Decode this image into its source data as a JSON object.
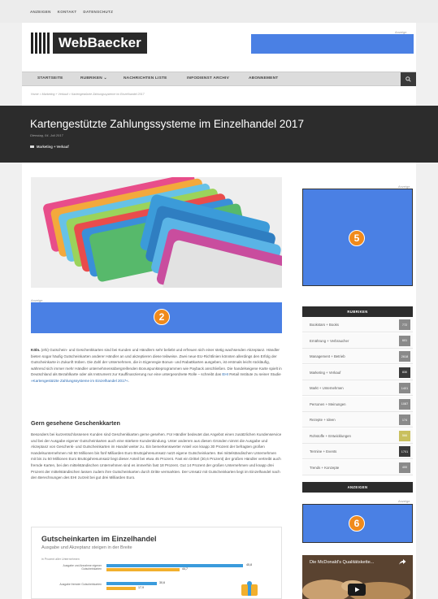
{
  "topbar": {
    "links": [
      "ANZEIGEN",
      "KONTAKT",
      "DATENSCHUTZ"
    ]
  },
  "header": {
    "logo_text": "WebBaecker",
    "ad_label": "Anzeige"
  },
  "nav": {
    "items": [
      "STARTSEITE",
      "RUBRIKEN ⌄",
      "NACHRICHTEN LISTE",
      "INFODIENST ARCHIV",
      "ABONNEMENT"
    ],
    "search_icon": "search-icon"
  },
  "breadcrumb": "Home  >  Marketing + Verkauf  >  Kartengestützte Zahlungssysteme im Einzelhandel 2017",
  "article": {
    "title": "Kartengestützte Zahlungssysteme im Einzelhandel 2017",
    "date": "Dienstag, 04. Juli 2017",
    "category": "Marketing + Verkauf",
    "ad_label": "Anzeige",
    "ad_number": "2",
    "lead_city": "Köln.",
    "lead_text": " (ehi) Gutschein- und Geschenkkarten sind bei Kunden und Händlern sehr beliebt und erfreuen sich einer stetig wachsenden Akzeptanz. Händler bieten sogar häufig Gutscheinkarten anderer Händler an und akzeptieren diese teilweise. Zwei neue EU-Richtlinien könnten allerdings den Erfolg der Gutscheinkarte in Zukunft trüben. Die Zahl der Unternehmen, die in Eigenregie Bonus- und Rabattkarten ausgeben, ist erstmals leicht rückläufig, während sich immer mehr Händler unternehmensübergreifenden Bonuspunkteprogrammen wie Payback anschließen. Die handelseigene Karte spielt in Deutschland als Bezahlkarte oder als Instrument zur Kauffinanzierung nur eine untergeordnete Rolle – schreibt das ",
    "lead_link1": "EHI",
    "lead_text2": " Retail Institute zu seiner Studie ",
    "lead_link2": "»Kartengestützte Zahlungssysteme im Einzelhandel 2017«",
    "lead_end": ".",
    "subheading": "Gern gesehene Geschenkkarten",
    "body_text": "Besonders bei kurzentschlossenen Kunden sind Geschenkkarten gerne gesehen. Für Händler bedeutet das Angebot einen zusätzlichen Kundenservice und bei der Ausgabe eigener Gutscheinkarten auch eine stärkere Kundenbindung. Unter anderem aus diesen Gründen nimmt die Ausgabe und Akzeptanz von Geschenk- und Gutscheinkarten im Handel weiter zu. Ein bemerkenswerter Anteil von knapp 30 Prozent der befragten großen Handelsunternehmen mit 50 Millionen bis fünf Milliarden Euro Bruttojahresumsatz nutzt eigene Gutscheinkarten. Bei mittelständischen Unternehmen mit bis zu 50 Millionen Euro Bruttojahresumsatz liegt dieser Anteil bei etwa 45 Prozent. Fast ein Drittel (30,6 Prozent) der großen Händler vertreibt auch fremde Karten, bei den mittelständischen Unternehmen sind es immerhin fast 18 Prozent. Gut 14 Prozent der großen Unternehmen und knapp drei Prozent der mittelständischen lassen zudem ihre Gutscheinkarten durch Dritte vermarkten. Der Umsatz mit Gutscheinkarten liegt im Einzelhandel nach den Berechnungen des EHI zurzeit bei gut drei Milliarden Euro."
  },
  "infographic": {
    "title": "Gutscheinkarten im Einzelhandel",
    "subtitle": "Ausgabe und Akzeptanz steigen in der Breite",
    "unit_label": "in Prozent aller Unternehmen",
    "rows": [
      {
        "label": "Ausgabe und Annahme eigener Gutscheinkarten",
        "values": [
          "45,8",
          "44,7"
        ]
      },
      {
        "label": "Ausgabe fremder Gutscheinkarten",
        "values": [
          "30,6",
          "17,9"
        ]
      }
    ]
  },
  "sidebar": {
    "ad_label_top": "Anzeige",
    "ad_number_top": "5",
    "rubriken_header": "RUBRIKEN",
    "rubriken": [
      {
        "label": "Bookstars + Books",
        "count": "772",
        "color": "#8a8a8a"
      },
      {
        "label": "Ernährung + Verbraucher",
        "count": "601",
        "color": "#8a8a8a"
      },
      {
        "label": "Management + Betrieb",
        "count": "2618",
        "color": "#8a8a8a"
      },
      {
        "label": "Marketing + Verkauf",
        "count": "830",
        "color": "#3a3a3a"
      },
      {
        "label": "Markt + Unternehmen",
        "count": "1401",
        "color": "#8a8a8a"
      },
      {
        "label": "Personen + Meinungen",
        "count": "1087",
        "color": "#8a8a8a"
      },
      {
        "label": "Rezepte + Ideen",
        "count": "174",
        "color": "#8a8a8a"
      },
      {
        "label": "Rohstoffe + Entwicklungen",
        "count": "566",
        "color": "#c9c05e"
      },
      {
        "label": "Termine + Events",
        "count": "1701",
        "color": "#3a3a3a"
      },
      {
        "label": "Trends + Konzepte",
        "count": "400",
        "color": "#8a8a8a"
      }
    ],
    "anzeigen_header": "ANZEIGEN",
    "ad_label_bottom": "Anzeige",
    "ad_number_bottom": "6",
    "video_title": "Die McDonald's Qualitätskette..."
  }
}
